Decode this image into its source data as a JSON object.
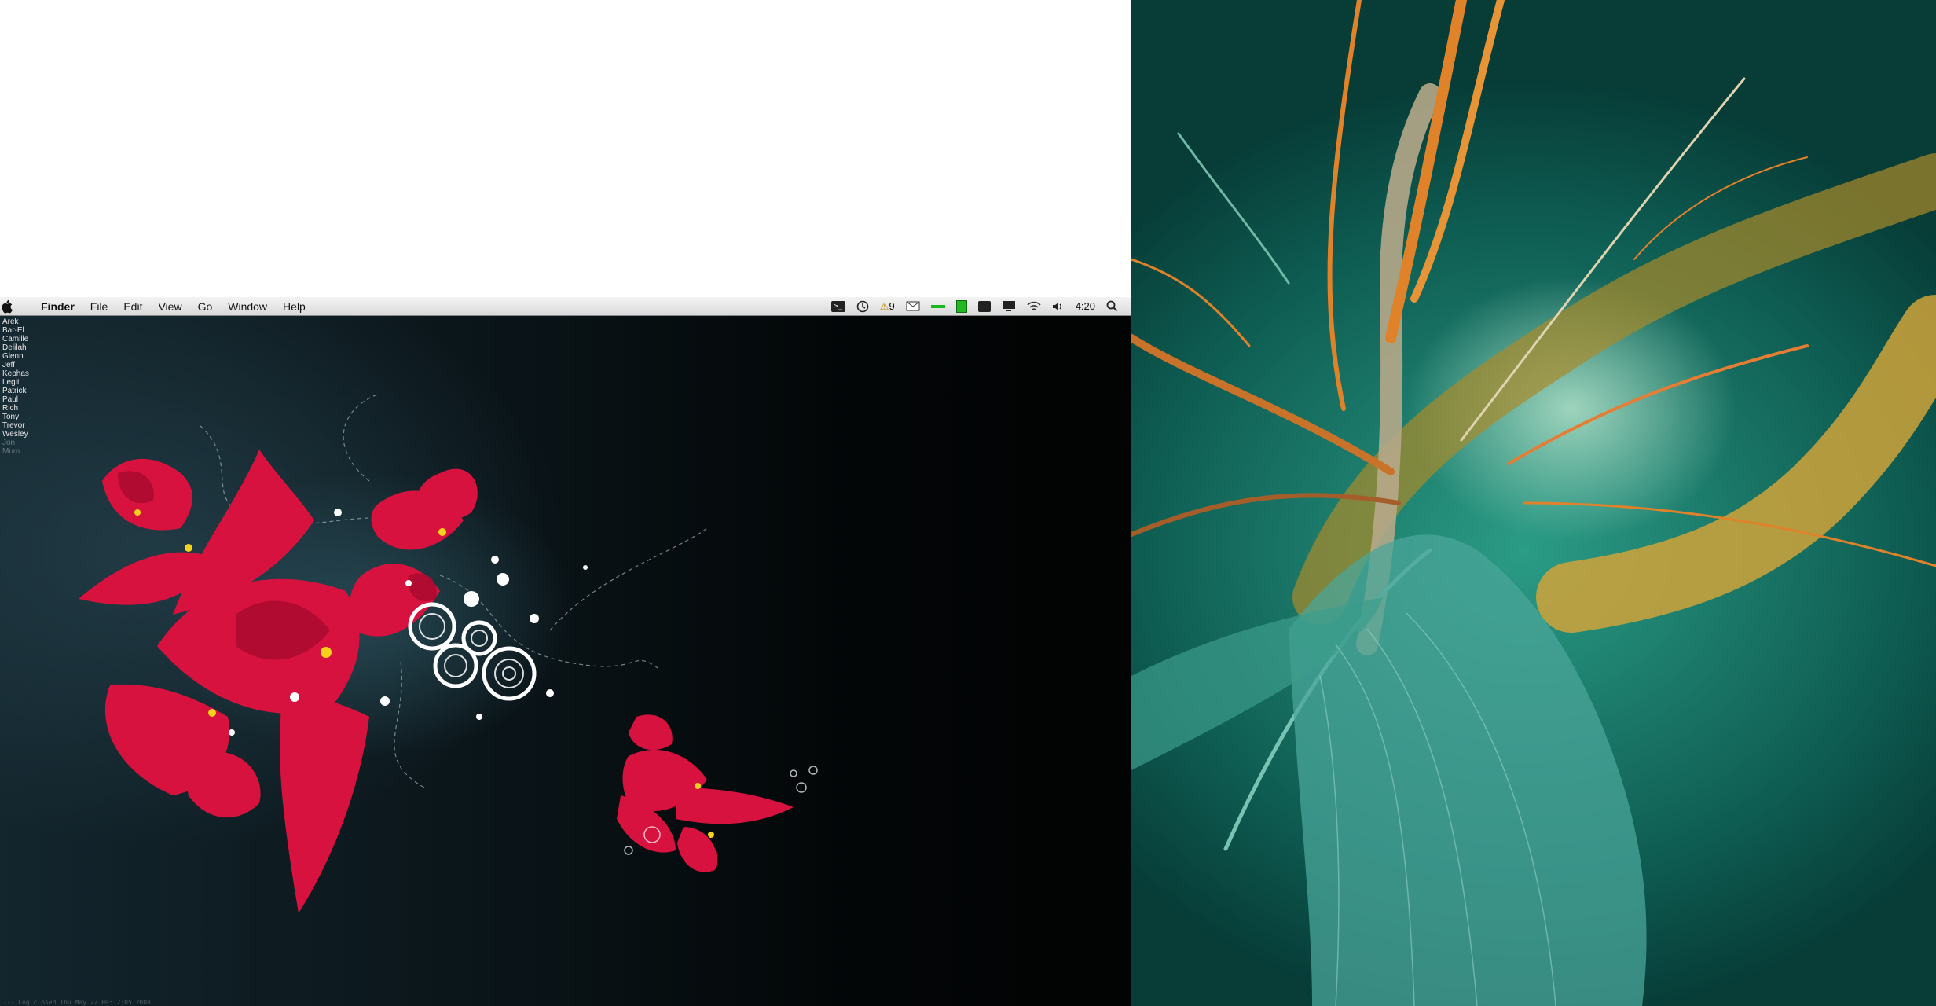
{
  "menubar": {
    "apple_icon": "apple-logo-icon",
    "app_name": "Finder",
    "menus": [
      "File",
      "Edit",
      "View",
      "Go",
      "Window",
      "Help"
    ],
    "status": {
      "alert_count": "9",
      "clock": "4:20"
    }
  },
  "buddy_list": {
    "online": [
      "Arek",
      "Bar-El",
      "Camille",
      "Delilah",
      "Glenn",
      "Jeff",
      "Kephas",
      "Legit",
      "Patrick",
      "Paul",
      "Rich",
      "Tony",
      "Trevor",
      "Wesley"
    ],
    "idle": [
      "Jon",
      "Mum"
    ]
  },
  "log_line": "--- Log closed Thu May 22 09:12:05 2008",
  "colors": {
    "flower_red": "#d8123f",
    "desktop_dark": "#0a1418",
    "right_teal": "#1e8a78",
    "tentacle_orange": "#e0822a"
  }
}
